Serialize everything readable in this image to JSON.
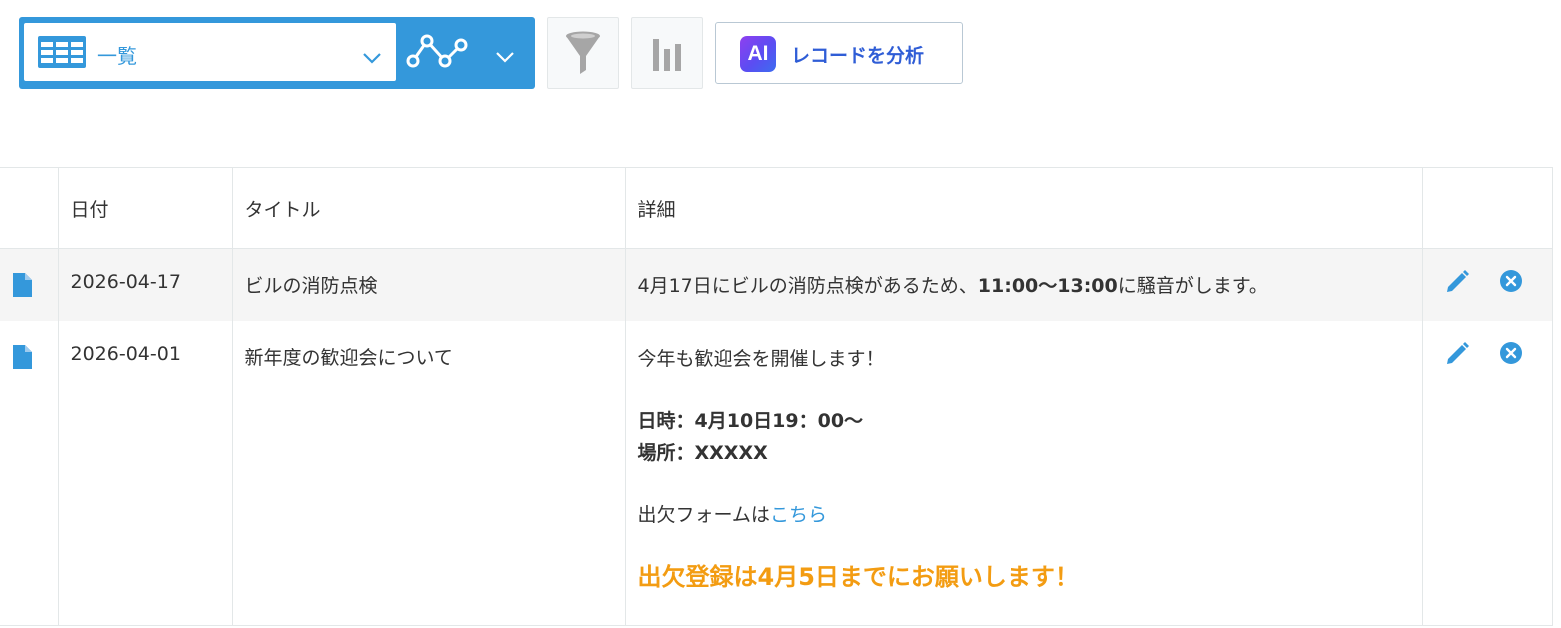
{
  "toolbar": {
    "view_name": "一覧",
    "ai_badge": "AI",
    "ai_label": "レコードを分析"
  },
  "table": {
    "headers": {
      "date": "日付",
      "title": "タイトル",
      "detail": "詳細"
    },
    "rows": [
      {
        "date": "2026-04-17",
        "title": "ビルの消防点検",
        "detail": {
          "before": "4月17日にビルの消防点検があるため、",
          "bold": "11:00〜13:00",
          "after": "に騒音がします。"
        }
      },
      {
        "date": "2026-04-01",
        "title": "新年度の歓迎会について",
        "detail": {
          "line1": "今年も歓迎会を開催します！",
          "datetime": "日時：4月10日19：00〜",
          "place": "場所：XXXXX",
          "form_text": "出欠フォームは",
          "form_link": "こちら",
          "notice": "出欠登録は4月5日までにお願いします！"
        }
      }
    ]
  },
  "colors": {
    "primary": "#3498db",
    "ai_text": "#2f5dd6",
    "notice": "#f39c12",
    "row_highlight": "#f5f5f5"
  },
  "icons": [
    "grid-view-icon",
    "chevron-down-icon",
    "line-graph-icon",
    "filter-funnel-icon",
    "bar-graph-icon",
    "ai-icon",
    "document-icon",
    "pencil-icon",
    "close-circle-icon"
  ]
}
